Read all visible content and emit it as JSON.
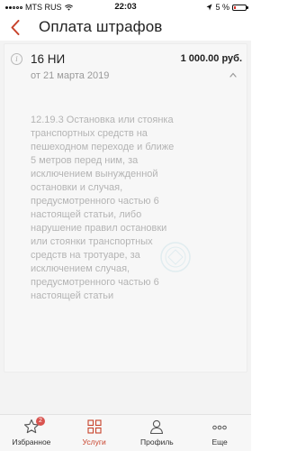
{
  "status_bar": {
    "carrier": "MTS RUS",
    "time": "22:03",
    "battery_percent": "5 %"
  },
  "nav": {
    "title": "Оплата штрафов"
  },
  "fine": {
    "number": "16 НИ",
    "amount": "1 000.00 руб.",
    "date": "от 21 марта 2019",
    "description": "12.19.3 Остановка или стоянка транспортных средств на пешеходном переходе и ближе 5 метров перед ним, за исключением вынужденной остановки и случая, предусмотренного частью 6 настоящей статьи, либо нарушение правил остановки или стоянки транспортных средств на тротуаре, за исключением случая, предусмотренного частью 6 настоящей статьи"
  },
  "tab_bar": {
    "tabs": [
      {
        "label": "Избранное",
        "icon": "star-icon",
        "badge": "2"
      },
      {
        "label": "Услуги",
        "icon": "grid-icon",
        "active": true
      },
      {
        "label": "Профиль",
        "icon": "person-icon"
      },
      {
        "label": "Еще",
        "icon": "more-icon"
      }
    ]
  },
  "colors": {
    "accent": "#c8432c",
    "badge": "#d9534f"
  }
}
